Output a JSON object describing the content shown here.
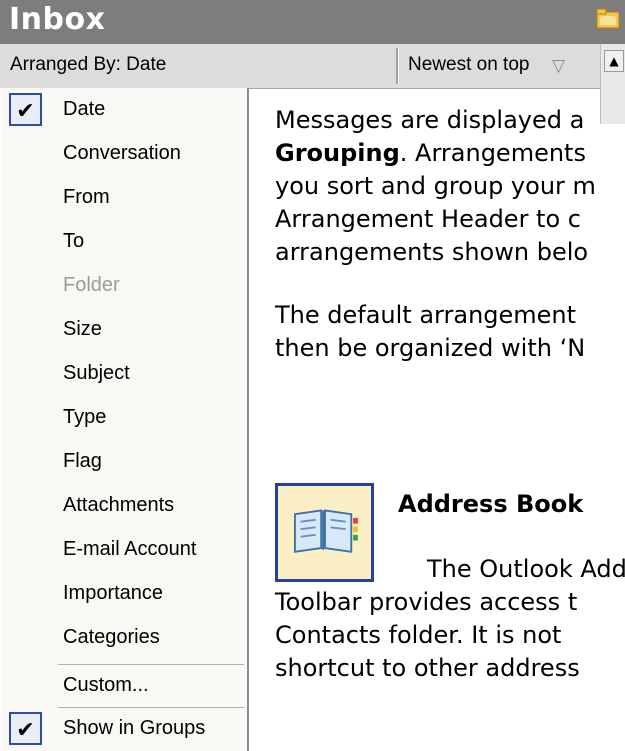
{
  "title": "Inbox",
  "header": {
    "arranged_by": "Arranged By: Date",
    "order": "Newest on top"
  },
  "menu": {
    "items": [
      {
        "label": "Date",
        "checked": true,
        "disabled": false
      },
      {
        "label": "Conversation",
        "checked": false,
        "disabled": false
      },
      {
        "label": "From",
        "checked": false,
        "disabled": false
      },
      {
        "label": "To",
        "checked": false,
        "disabled": false
      },
      {
        "label": "Folder",
        "checked": false,
        "disabled": true
      },
      {
        "label": "Size",
        "checked": false,
        "disabled": false
      },
      {
        "label": "Subject",
        "checked": false,
        "disabled": false
      },
      {
        "label": "Type",
        "checked": false,
        "disabled": false
      },
      {
        "label": "Flag",
        "checked": false,
        "disabled": false
      },
      {
        "label": "Attachments",
        "checked": false,
        "disabled": false
      },
      {
        "label": "E-mail Account",
        "checked": false,
        "disabled": false
      },
      {
        "label": "Importance",
        "checked": false,
        "disabled": false
      },
      {
        "label": "Categories",
        "checked": false,
        "disabled": false
      }
    ],
    "custom": "Custom...",
    "show_in_groups": "Show in Groups",
    "show_in_groups_checked": true
  },
  "body_text": {
    "para1_line1": "Messages are displayed a",
    "para1_line2_bold": "Grouping",
    "para1_line2_rest": ". Arrangements",
    "para1_line3": "you sort and group your m",
    "para1_line4": "Arrangement Header to c",
    "para1_line5": "arrangements shown belo",
    "para2_line1": "The default arrangement",
    "para2_line2": "then be organized with ‘N"
  },
  "address_book": {
    "title": "Address Book",
    "line1": "The Outlook Add",
    "line2": "Toolbar provides access t",
    "line3": "Contacts folder.  It is not",
    "line4": "shortcut to other address"
  },
  "icons": {
    "checkmark": "✔"
  },
  "colors": {
    "title_bar": "#7d7d7d",
    "header_bar": "#dcdcdc",
    "menu_bg": "#f9f8f5",
    "check_border": "#2f4e9b"
  }
}
